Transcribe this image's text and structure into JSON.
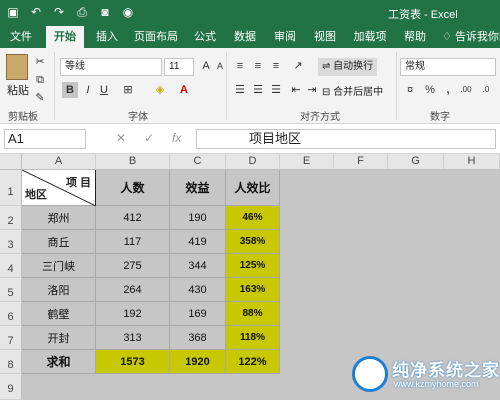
{
  "window": {
    "title": "工资表 - Excel"
  },
  "colors": {
    "brand": "#217346",
    "highlight": "#c8c800",
    "grid_bg": "#c6c6c6"
  },
  "quick_access": [
    "save-icon",
    "undo-icon",
    "redo-icon",
    "print-preview-icon",
    "camera-icon",
    "screenshot-icon"
  ],
  "tabs": [
    "文件",
    "开始",
    "插入",
    "页面布局",
    "公式",
    "数据",
    "审阅",
    "视图",
    "加载项",
    "帮助"
  ],
  "active_tab": "开始",
  "tell_me": "告诉我你想",
  "ribbon": {
    "paste": "粘贴",
    "clipboard_label": "剪贴板",
    "font_name": "等线",
    "font_size": "11",
    "font_label": "字体",
    "bold": "B",
    "italic": "I",
    "underline": "U",
    "wrap_text": "自动换行",
    "merge_center": "合并后居中",
    "alignment_label": "对齐方式",
    "number_format": "常规",
    "number_label": "数字"
  },
  "formula_bar": {
    "name_box": "A1",
    "fx": "fx",
    "content": "项目地区"
  },
  "grid": {
    "columns": [
      "A",
      "B",
      "C",
      "D",
      "E",
      "F",
      "G",
      "H"
    ],
    "rows": [
      "1",
      "2",
      "3",
      "4",
      "5",
      "6",
      "7",
      "8",
      "9"
    ],
    "header_cell": {
      "top_right": "项 目",
      "bottom_left": "地区"
    },
    "headers": [
      "人数",
      "效益",
      "人效比"
    ],
    "data": [
      {
        "region": "郑州",
        "people": "412",
        "benefit": "190",
        "ratio": "46%"
      },
      {
        "region": "商丘",
        "people": "117",
        "benefit": "419",
        "ratio": "358%"
      },
      {
        "region": "三门峡",
        "people": "275",
        "benefit": "344",
        "ratio": "125%"
      },
      {
        "region": "洛阳",
        "people": "264",
        "benefit": "430",
        "ratio": "163%"
      },
      {
        "region": "鹤壁",
        "people": "192",
        "benefit": "169",
        "ratio": "88%"
      },
      {
        "region": "开封",
        "people": "313",
        "benefit": "368",
        "ratio": "118%"
      }
    ],
    "total": {
      "label": "求和",
      "people": "1573",
      "benefit": "1920",
      "ratio": "122%"
    }
  },
  "watermark": {
    "name": "纯净系统之家",
    "url": "www.kzmyhome.com"
  }
}
